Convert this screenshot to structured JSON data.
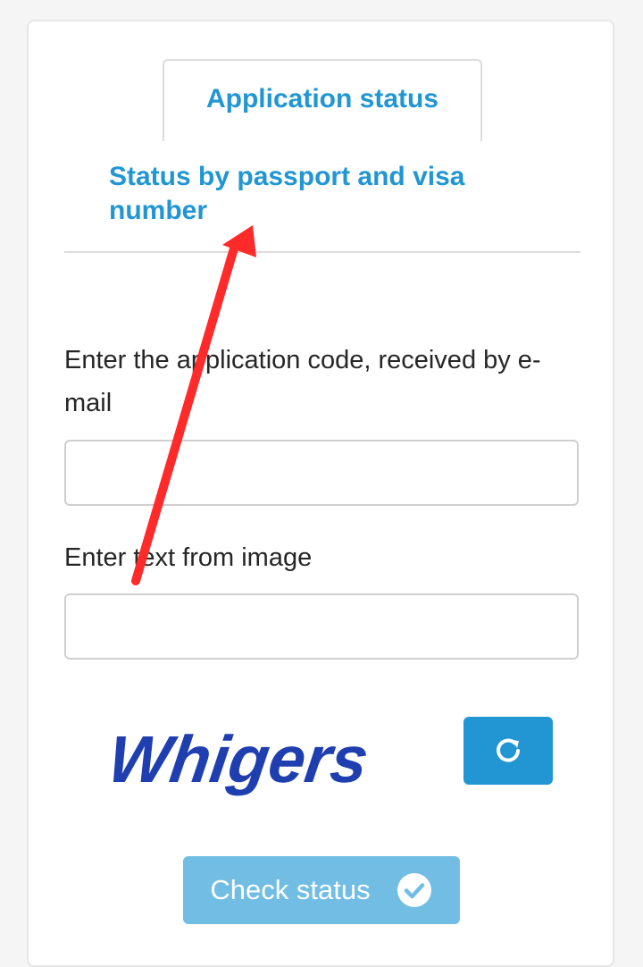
{
  "tabs": {
    "active_label": "Application status",
    "inactive_label": "Status by passport and visa number"
  },
  "form": {
    "code_label": "Enter the application code, received by e-mail",
    "code_value": "",
    "captcha_label": "Enter text from image",
    "captcha_value": "",
    "captcha_image_text": "Whigers"
  },
  "buttons": {
    "refresh_icon": "refresh-icon",
    "check_label": "Check status",
    "check_icon": "check-circle-icon"
  },
  "colors": {
    "accent": "#2196d3",
    "button_disabled": "#72bde4",
    "annotation_arrow": "#ff2a2a"
  }
}
